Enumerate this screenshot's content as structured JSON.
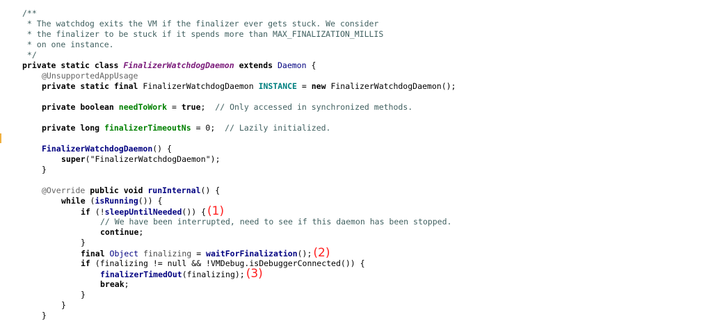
{
  "editor": {
    "lines": [
      {
        "indent": 0,
        "tokens": [
          {
            "t": "/**",
            "c": "doc"
          }
        ]
      },
      {
        "indent": 0,
        "tokens": [
          {
            "t": " * The watchdog exits the VM if the finalizer ever gets stuck. We consider",
            "c": "doc"
          }
        ]
      },
      {
        "indent": 0,
        "tokens": [
          {
            "t": " * the finalizer to be stuck if it spends more than MAX_FINALIZATION_MILLIS",
            "c": "doc"
          }
        ]
      },
      {
        "indent": 0,
        "tokens": [
          {
            "t": " * on one instance.",
            "c": "doc"
          }
        ]
      },
      {
        "indent": 0,
        "tokens": [
          {
            "t": " */",
            "c": "doc"
          }
        ]
      },
      {
        "indent": 0,
        "tokens": [
          {
            "t": "private static class ",
            "c": "kw-plain"
          },
          {
            "t": "FinalizerWatchdogDaemon",
            "c": "cls-italic"
          },
          {
            "t": " extends ",
            "c": "kw-plain"
          },
          {
            "t": "Daemon",
            "c": "type"
          },
          {
            "t": " {",
            "c": "sym"
          }
        ]
      },
      {
        "indent": 1,
        "tokens": [
          {
            "t": "@UnsupportedAppUsage",
            "c": "anno"
          }
        ]
      },
      {
        "indent": 1,
        "tokens": [
          {
            "t": "private static final ",
            "c": "kw-plain"
          },
          {
            "t": "FinalizerWatchdogDaemon ",
            "c": "plain"
          },
          {
            "t": "INSTANCE",
            "c": "static-field"
          },
          {
            "t": " = ",
            "c": "sym"
          },
          {
            "t": "new ",
            "c": "kw-plain"
          },
          {
            "t": "FinalizerWatchdogDaemon();",
            "c": "plain"
          }
        ]
      },
      {
        "indent": 1,
        "tokens": []
      },
      {
        "indent": 1,
        "tokens": [
          {
            "t": "private boolean ",
            "c": "kw-plain"
          },
          {
            "t": "needToWork",
            "c": "field-bold"
          },
          {
            "t": " = ",
            "c": "sym"
          },
          {
            "t": "true",
            "c": "kw-plain"
          },
          {
            "t": ";  ",
            "c": "sym"
          },
          {
            "t": "// Only accessed in synchronized methods.",
            "c": "cmt"
          }
        ]
      },
      {
        "indent": 1,
        "tokens": []
      },
      {
        "indent": 1,
        "tokens": [
          {
            "t": "private long ",
            "c": "kw-plain"
          },
          {
            "t": "finalizerTimeoutNs",
            "c": "field-bold"
          },
          {
            "t": " = ",
            "c": "sym"
          },
          {
            "t": "0",
            "c": "num"
          },
          {
            "t": ";  ",
            "c": "sym"
          },
          {
            "t": "// Lazily initialized.",
            "c": "cmt"
          }
        ]
      },
      {
        "indent": 1,
        "tokens": []
      },
      {
        "indent": 1,
        "tokens": [
          {
            "t": "FinalizerWatchdogDaemon",
            "c": "ident-bold"
          },
          {
            "t": "() {",
            "c": "sym"
          }
        ]
      },
      {
        "indent": 2,
        "tokens": [
          {
            "t": "super",
            "c": "kw-plain"
          },
          {
            "t": "(",
            "c": "sym"
          },
          {
            "t": "\"FinalizerWatchdogDaemon\"",
            "c": "plain"
          },
          {
            "t": ");",
            "c": "sym"
          }
        ]
      },
      {
        "indent": 1,
        "tokens": [
          {
            "t": "}",
            "c": "sym"
          }
        ]
      },
      {
        "indent": 1,
        "tokens": []
      },
      {
        "indent": 1,
        "tokens": [
          {
            "t": "@Override ",
            "c": "anno"
          },
          {
            "t": "public void ",
            "c": "kw-plain"
          },
          {
            "t": "runInternal",
            "c": "method-bold"
          },
          {
            "t": "() {",
            "c": "sym"
          }
        ]
      },
      {
        "indent": 2,
        "tokens": [
          {
            "t": "while",
            "c": "kw-plain"
          },
          {
            "t": " (",
            "c": "sym"
          },
          {
            "t": "isRunning",
            "c": "method-bold"
          },
          {
            "t": "()) {",
            "c": "sym"
          }
        ]
      },
      {
        "indent": 3,
        "tokens": [
          {
            "t": "if",
            "c": "kw-plain"
          },
          {
            "t": " (!",
            "c": "sym"
          },
          {
            "t": "sleepUntilNeeded",
            "c": "method-bold"
          },
          {
            "t": "()) {",
            "c": "sym"
          }
        ],
        "annotation": "(1)"
      },
      {
        "indent": 4,
        "tokens": [
          {
            "t": "// We have been interrupted, need to see if this daemon has been stopped.",
            "c": "cmt"
          }
        ]
      },
      {
        "indent": 4,
        "tokens": [
          {
            "t": "continue",
            "c": "kw-plain"
          },
          {
            "t": ";",
            "c": "sym"
          }
        ]
      },
      {
        "indent": 3,
        "tokens": [
          {
            "t": "}",
            "c": "sym"
          }
        ]
      },
      {
        "indent": 3,
        "tokens": [
          {
            "t": "final ",
            "c": "kw-plain"
          },
          {
            "t": "Object ",
            "c": "type"
          },
          {
            "t": "finalizing",
            "c": "var"
          },
          {
            "t": " = ",
            "c": "sym"
          },
          {
            "t": "waitForFinalization",
            "c": "method-bold"
          },
          {
            "t": "();",
            "c": "sym"
          }
        ],
        "annotation": "(2)"
      },
      {
        "indent": 3,
        "tokens": [
          {
            "t": "if",
            "c": "kw-plain"
          },
          {
            "t": " (finalizing != ",
            "c": "sym"
          },
          {
            "t": "null",
            "c": "plain"
          },
          {
            "t": " && !VMDebug.",
            "c": "sym"
          },
          {
            "t": "isDebuggerConnected",
            "c": "plain"
          },
          {
            "t": "()) {",
            "c": "sym"
          }
        ]
      },
      {
        "indent": 4,
        "tokens": [
          {
            "t": "finalizerTimedOut",
            "c": "method-bold"
          },
          {
            "t": "(finalizing);",
            "c": "sym"
          }
        ],
        "annotation": "(3)"
      },
      {
        "indent": 4,
        "tokens": [
          {
            "t": "break",
            "c": "kw-plain"
          },
          {
            "t": ";",
            "c": "sym"
          }
        ]
      },
      {
        "indent": 3,
        "tokens": [
          {
            "t": "}",
            "c": "sym"
          }
        ]
      },
      {
        "indent": 2,
        "tokens": [
          {
            "t": "}",
            "c": "sym"
          }
        ]
      },
      {
        "indent": 1,
        "tokens": [
          {
            "t": "}",
            "c": "sym"
          }
        ]
      }
    ]
  }
}
